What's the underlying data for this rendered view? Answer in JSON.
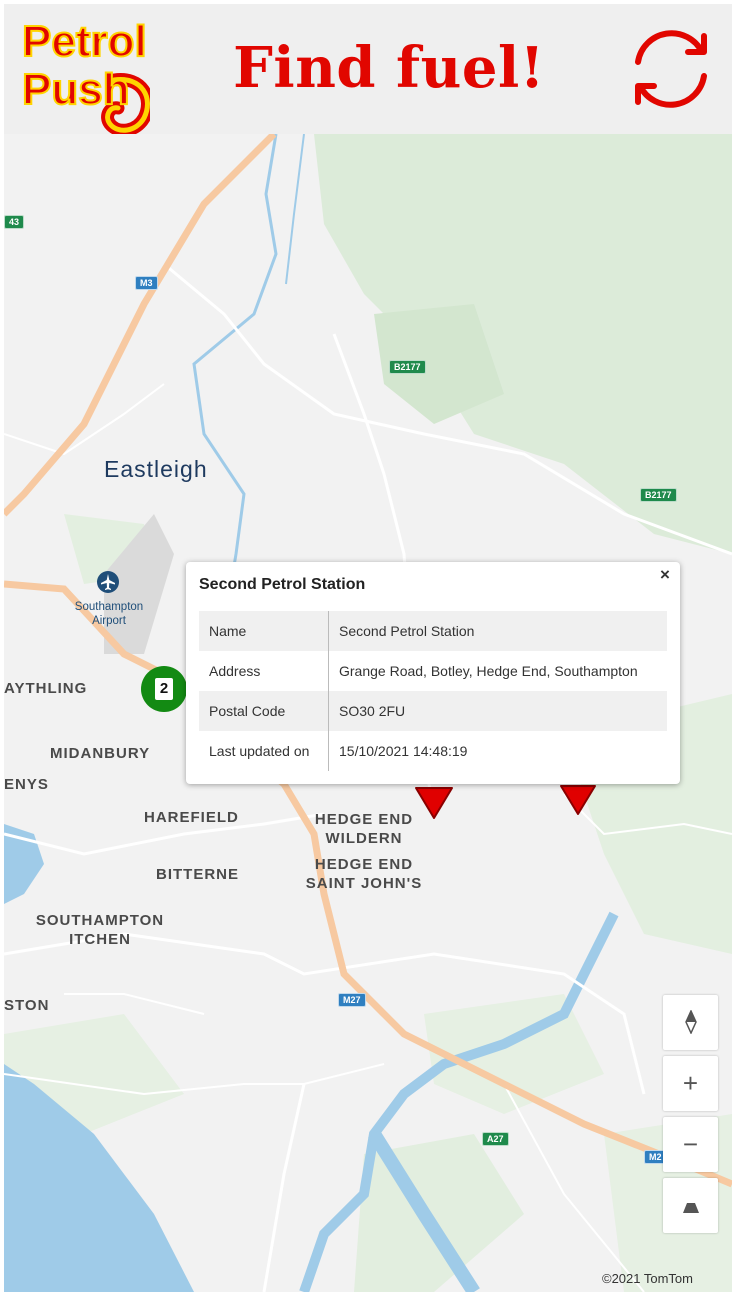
{
  "header": {
    "logo_line1": "Petrol",
    "logo_line2": "Push",
    "title": "Find fuel!"
  },
  "colors": {
    "brand_red": "#e10600",
    "logo_yellow": "#ffd400",
    "marker_red": "#e00000",
    "cluster_green": "#138a13"
  },
  "icons": {
    "refresh": "refresh-icon",
    "close": "close-icon",
    "compass": "compass-icon",
    "zoom_in": "plus-icon",
    "zoom_out": "minus-icon",
    "pitch": "pitch-icon",
    "airport": "airplane-icon"
  },
  "map": {
    "city": "Eastleigh",
    "airport_line1": "Southampton",
    "airport_line2": "Airport",
    "places": [
      {
        "line1": "AYTHLING",
        "line2": ""
      },
      {
        "line1": "MIDANBURY",
        "line2": ""
      },
      {
        "line1": "ENYS",
        "line2": ""
      },
      {
        "line1": "HAREFIELD",
        "line2": ""
      },
      {
        "line1": "HEDGE END",
        "line2": "WILDERN"
      },
      {
        "line1": "HEDGE END",
        "line2": "SAINT JOHN'S"
      },
      {
        "line1": "BITTERNE",
        "line2": ""
      },
      {
        "line1": "SOUTHAMPTON",
        "line2": "ITCHEN"
      },
      {
        "line1": "STON",
        "line2": ""
      }
    ],
    "road_shields": [
      "43",
      "M3",
      "B2177",
      "B2177",
      "M27",
      "A27",
      "M2"
    ],
    "cluster_count": "2",
    "copyright": "©2021 TomTom"
  },
  "popup": {
    "title": "Second Petrol Station",
    "close_label": "×",
    "rows": [
      {
        "key": "Name",
        "value": "Second Petrol Station"
      },
      {
        "key": "Address",
        "value": "Grange Road, Botley, Hedge End, Southampton"
      },
      {
        "key": "Postal Code",
        "value": "SO30 2FU"
      },
      {
        "key": "Last updated on",
        "value": "15/10/2021 14:48:19"
      }
    ]
  },
  "controls": {
    "zoom_in_label": "+",
    "zoom_out_label": "−"
  }
}
